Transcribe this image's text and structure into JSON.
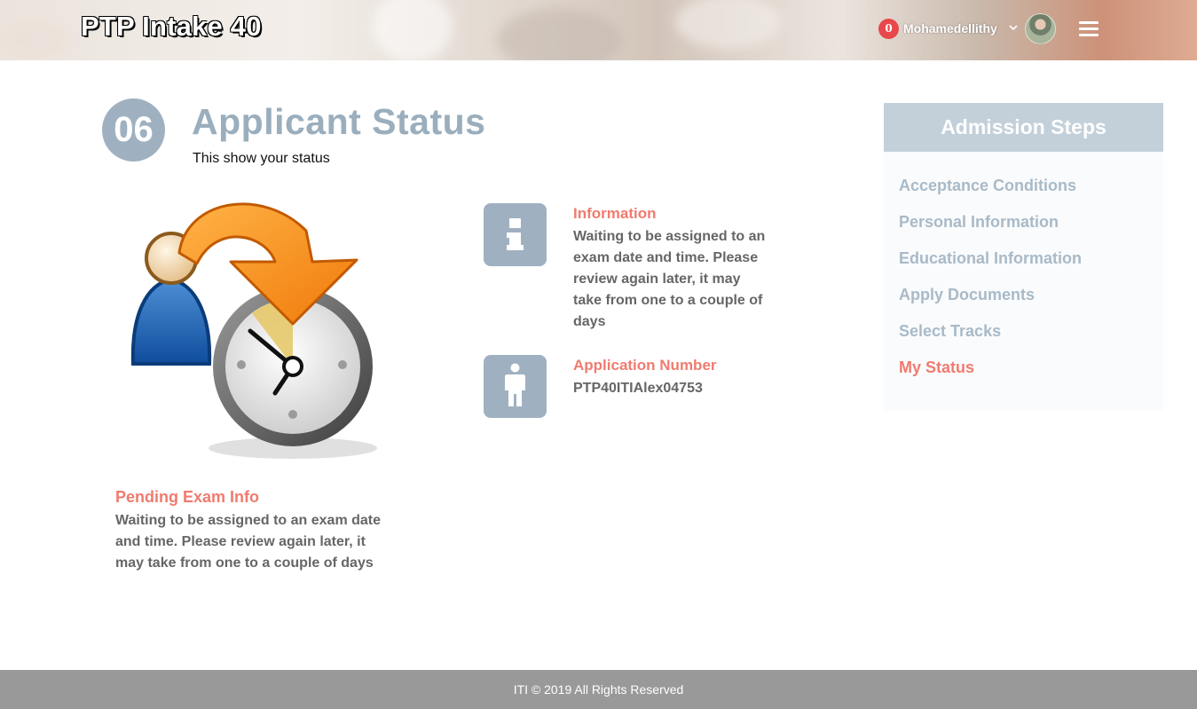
{
  "header": {
    "title": "PTP Intake 40",
    "notifications_count": "0",
    "username": "Mohamedellithy"
  },
  "main": {
    "step_number": "06",
    "title": "Applicant Status",
    "subtitle": "This show your status",
    "pending": {
      "title": "Pending Exam Info",
      "text": "Waiting to be assigned to an exam date and time. Please review again later, it may take from one to a couple of days"
    },
    "information": {
      "title": "Information",
      "text": "Waiting to be assigned to an exam date and time. Please review again later, it may take from one to a couple of days"
    },
    "application_number": {
      "title": "Application Number",
      "value": "PTP40ITIAlex04753"
    }
  },
  "sidebar": {
    "title": "Admission Steps",
    "items": [
      {
        "label": "Acceptance Conditions"
      },
      {
        "label": "Personal Information"
      },
      {
        "label": "Educational Information"
      },
      {
        "label": "Apply Documents"
      },
      {
        "label": "Select Tracks"
      },
      {
        "label": "My Status"
      }
    ]
  },
  "footer": {
    "text": "ITI © 2019 All Rights Reserved"
  },
  "colors": {
    "accent": "#f07b6f",
    "muted_blue": "#9fb1c1",
    "footer_bg": "#999999"
  },
  "icons": {
    "info_box": "info-icon",
    "person_box": "person-icon",
    "illustration": "pending-clock-illustration"
  }
}
